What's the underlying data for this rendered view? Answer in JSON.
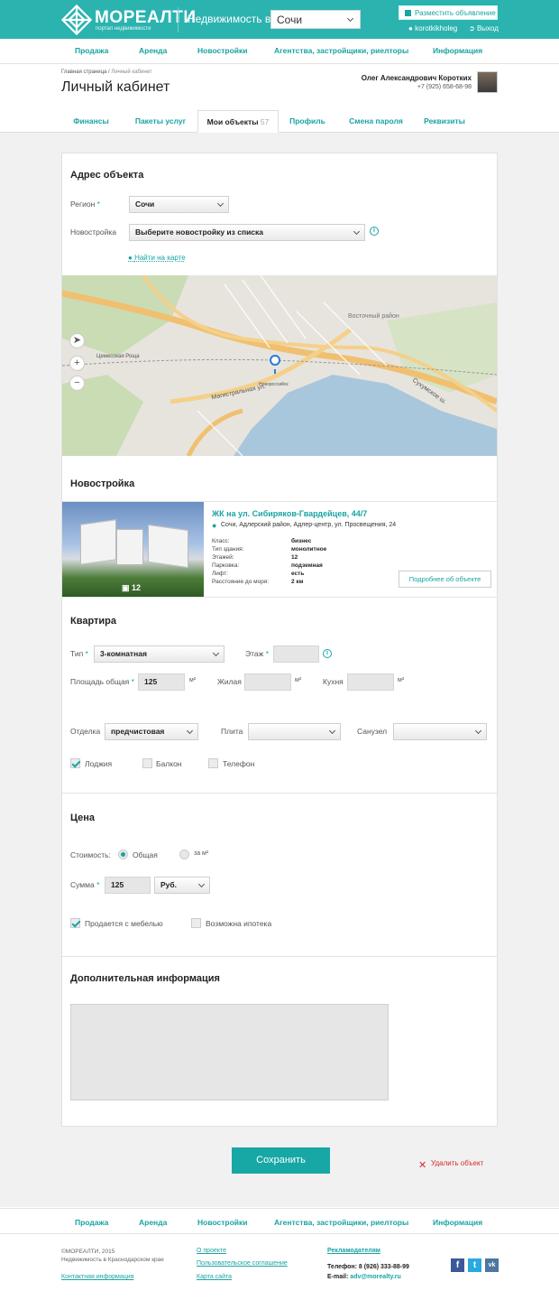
{
  "header": {
    "logo": "МОРЕАЛТИ",
    "logo_sub": "портал недвижимости",
    "realty_label": "Недвижимость в",
    "city": "Сочи",
    "post_ad": "Разместить объявление",
    "username": "korotkikholeg",
    "logout": "Выход",
    "colors": {
      "brand": "#2bb3b0",
      "link": "#1aa3a3",
      "danger": "#d42a2a"
    }
  },
  "nav": [
    "Продажа",
    "Аренда",
    "Новостройки",
    "Агентства, застройщики, риелторы",
    "Информация"
  ],
  "breadcrumb": {
    "home": "Главная страница",
    "sep": "/",
    "current": "Личный кабинет"
  },
  "page_title": "Личный кабинет",
  "user": {
    "name": "Олег Александрович Коротких",
    "phone": "+7 (925) 658-68-98"
  },
  "tabs": [
    {
      "label": "Финансы"
    },
    {
      "label": "Пакеты услуг"
    },
    {
      "label": "Мои объекты",
      "count": "57",
      "active": true
    },
    {
      "label": "Профиль"
    },
    {
      "label": "Смена пароля"
    },
    {
      "label": "Реквизиты"
    }
  ],
  "address": {
    "title": "Адрес объекта",
    "region_label": "Регион",
    "region_value": "Сочи",
    "new_building_label": "Новостройка",
    "new_building_placeholder": "Выберите новостройку из списка",
    "map_link": "Найти на карте",
    "map_labels": [
      "Восточный район",
      "Магистральная ул.",
      "Сухумское ш.",
      "Цемесская Роща",
      "Новороссийск"
    ]
  },
  "development": {
    "title": "Новостройка",
    "name": "ЖК на ул. Сибиряков-Гвардейцев, 44/7",
    "address": "Сочи, Адлерский район, Адлер-центр, ул. Просвещения, 24",
    "photo_count": "12",
    "props": [
      {
        "k": "Класс:",
        "v": "бизнес"
      },
      {
        "k": "Тип здания:",
        "v": "монолитное"
      },
      {
        "k": "Этажей:",
        "v": "12"
      },
      {
        "k": "Парковка:",
        "v": "подземная"
      },
      {
        "k": "Лифт:",
        "v": "есть"
      },
      {
        "k": "Расстояние до моря:",
        "v": "2 км"
      }
    ],
    "more": "Подробнее об объекте"
  },
  "apartment": {
    "title": "Квартира",
    "type_label": "Тип",
    "type_value": "3-комнатная",
    "floor_label": "Этаж",
    "area_label": "Площадь общая",
    "area_value": "125",
    "living_label": "Жилая",
    "kitchen_label": "Кухня",
    "unit": "м²",
    "finish_label": "Отделка",
    "finish_value": "предчистовая",
    "stove_label": "Плита",
    "bath_label": "Санузел",
    "loggia": "Лоджия",
    "balcony": "Балкон",
    "phone": "Телефон"
  },
  "price": {
    "title": "Цена",
    "cost_label": "Стоимость:",
    "total": "Общая",
    "per_m2": "за м²",
    "sum_label": "Сумма",
    "sum_value": "125",
    "currency": "Руб.",
    "furniture": "Продается с мебелью",
    "mortgage": "Возможна ипотека"
  },
  "extra": {
    "title": "Дополнительная информация"
  },
  "actions": {
    "save": "Сохранить",
    "delete": "Удалить объект"
  },
  "footer": {
    "copyright": "©МОРЕАЛТИ, 2015",
    "tagline": "Недвижимость в Краснодарском крае",
    "contacts": "Контактная информация",
    "about": "О проекте",
    "agreement": "Пользовательское соглашение",
    "sitemap": "Карта сайта",
    "advertisers": "Рекламодателям",
    "phone_label": "Телефон:",
    "phone": "8 (926) 333-88-99",
    "email_label": "E-mail:",
    "email": "adv@morealty.ru"
  }
}
